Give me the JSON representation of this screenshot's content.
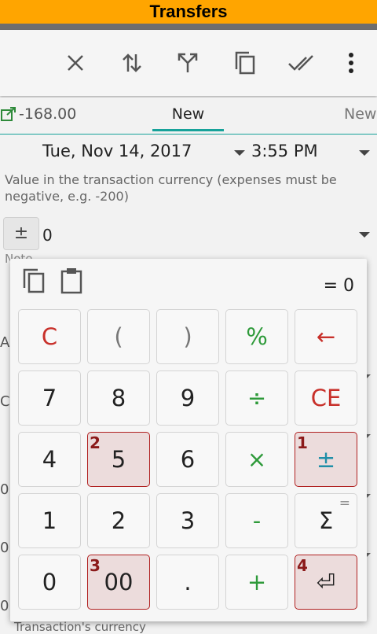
{
  "title_bar": {
    "title": "Transfers"
  },
  "toolbar": {
    "icons": [
      "close-icon",
      "swap-icon",
      "split-icon",
      "copy-icon",
      "done-all-icon",
      "more-vert-icon"
    ]
  },
  "tabs": {
    "left_value": "-168.00",
    "current": "New",
    "next": "New"
  },
  "form": {
    "date": "Tue, Nov 14, 2017",
    "time": "3:55 PM",
    "hint": "Value in the transaction currency (expenses must be negative, e.g. -200)",
    "sign_button": "±",
    "amount": "0",
    "note_label": "Note",
    "bottom_label": "Transaction's currency"
  },
  "calculator": {
    "result": "= 0",
    "keys": [
      [
        {
          "label": "C"
        },
        {
          "label": "("
        },
        {
          "label": ")"
        },
        {
          "label": "%"
        },
        {
          "label": "←"
        }
      ],
      [
        {
          "label": "7"
        },
        {
          "label": "8"
        },
        {
          "label": "9"
        },
        {
          "label": "÷"
        },
        {
          "label": "CE"
        }
      ],
      [
        {
          "label": "4"
        },
        {
          "label": "5",
          "badge": "2"
        },
        {
          "label": "6"
        },
        {
          "label": "×"
        },
        {
          "label": "±",
          "badge": "1"
        }
      ],
      [
        {
          "label": "1"
        },
        {
          "label": "2"
        },
        {
          "label": "3"
        },
        {
          "label": "-"
        },
        {
          "label": "Σ",
          "sup": "="
        }
      ],
      [
        {
          "label": "0"
        },
        {
          "label": "00",
          "badge": "3"
        },
        {
          "label": "."
        },
        {
          "label": "+"
        },
        {
          "label": "⏎",
          "badge": "4"
        }
      ]
    ]
  },
  "colors": {
    "title_bar": "#ffa500",
    "accent": "#17a29a",
    "operator": "#2e9a3a",
    "clear": "#c8302a",
    "highlight": "#ecdcdc"
  }
}
